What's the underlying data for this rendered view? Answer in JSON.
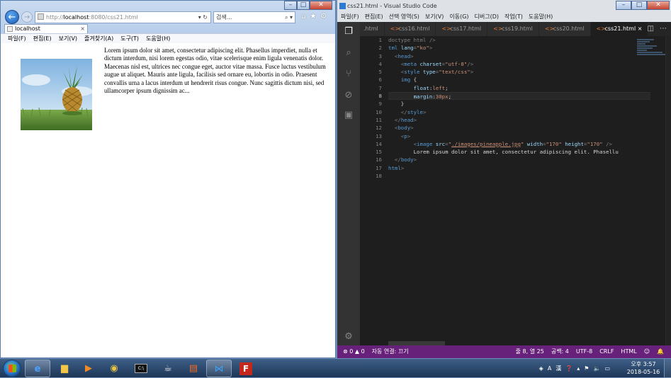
{
  "ie": {
    "address_prefix": "http://",
    "address_domain": "localhost",
    "address_suffix": ":8080/css21.html",
    "address_tools": "▾ ↻",
    "search_placeholder": "검색...",
    "search_tools": "⌕ ▾",
    "tab_title": "localhost",
    "tab_close": "×",
    "menu": [
      "파일(F)",
      "편집(E)",
      "보기(V)",
      "즐겨찾기(A)",
      "도구(T)",
      "도움말(H)"
    ],
    "page_text": "Lorem ipsum dolor sit amet, consectetur adipiscing elit. Phasellus imperdiet, nulla et dictum interdum, nisi lorem egestas odio, vitae scelerisque enim ligula venenatis dolor. Maecenas nisl est, ultrices nec congue eget, auctor vitae massa. Fusce luctus vestibulum augue ut aliquet. Mauris ante ligula, facilisis sed ornare eu, lobortis in odio. Praesent convallis urna a lacus interdum ut hendrerit risus congue. Nunc sagittis dictum nisi, sed ullamcorper ipsum dignissim ac..."
  },
  "vscode": {
    "title": "css21.html - Visual Studio Code",
    "menu": [
      "파일(F)",
      "편집(E)",
      "선택 영역(S)",
      "보기(V)",
      "이동(G)",
      "디버그(D)",
      "작업(T)",
      "도움말(H)"
    ],
    "tabs": [
      ".html",
      "css16.html",
      "css17.html",
      "css19.html",
      "css20.html",
      "css21.html"
    ],
    "active_tab_index": 5,
    "tab_close": "×",
    "line_numbers": [
      "1",
      "2",
      "3",
      "4",
      "5",
      "6",
      "7",
      "8",
      "9",
      "10",
      "11",
      "12",
      "13",
      "14",
      "15",
      "16",
      "17",
      "18"
    ],
    "current_line": 8,
    "code_lines": [
      [
        [
          "p",
          "doctype html />"
        ]
      ],
      [
        [
          "t",
          "tml "
        ],
        [
          "a",
          "lang"
        ],
        [
          "p",
          "="
        ],
        [
          "s",
          "\"ko\""
        ],
        [
          "p",
          ">"
        ]
      ],
      [
        [
          "p",
          "  <"
        ],
        [
          "t",
          "head"
        ],
        [
          "p",
          ">"
        ]
      ],
      [
        [
          "p",
          "    <"
        ],
        [
          "t",
          "meta "
        ],
        [
          "a",
          "charset"
        ],
        [
          "p",
          "="
        ],
        [
          "s",
          "\"utf-8\""
        ],
        [
          "p",
          "/>"
        ]
      ],
      [
        [
          "p",
          "    <"
        ],
        [
          "t",
          "style "
        ],
        [
          "a",
          "type"
        ],
        [
          "p",
          "="
        ],
        [
          "s",
          "\"text/css\""
        ],
        [
          "p",
          ">"
        ]
      ],
      [
        [
          "p",
          "    "
        ],
        [
          "t",
          "img"
        ],
        [
          "d",
          " {"
        ]
      ],
      [
        [
          "p",
          "        "
        ],
        [
          "a",
          "float"
        ],
        [
          "d",
          ":"
        ],
        [
          "s",
          "left"
        ],
        [
          "d",
          ";"
        ]
      ],
      [
        [
          "p",
          "        "
        ],
        [
          "a",
          "margin"
        ],
        [
          "d",
          ":"
        ],
        [
          "s",
          "30px"
        ],
        [
          "d",
          ";"
        ]
      ],
      [
        [
          "d",
          "    }"
        ]
      ],
      [
        [
          "p",
          "    </"
        ],
        [
          "t",
          "style"
        ],
        [
          "p",
          ">"
        ]
      ],
      [
        [
          "p",
          "  </"
        ],
        [
          "t",
          "head"
        ],
        [
          "p",
          ">"
        ]
      ],
      [
        [
          "p",
          "  <"
        ],
        [
          "t",
          "body"
        ],
        [
          "p",
          ">"
        ]
      ],
      [
        [
          "p",
          "    <"
        ],
        [
          "t",
          "p"
        ],
        [
          "p",
          ">"
        ]
      ],
      [
        [
          "p",
          "        <"
        ],
        [
          "t",
          "image "
        ],
        [
          "a",
          "src"
        ],
        [
          "p",
          "="
        ],
        [
          "s",
          "\""
        ],
        [
          "u",
          "./images/pineapple.jpg"
        ],
        [
          "s",
          "\""
        ],
        [
          "a",
          " width"
        ],
        [
          "p",
          "="
        ],
        [
          "s",
          "\"170\""
        ],
        [
          "a",
          " height"
        ],
        [
          "p",
          "="
        ],
        [
          "s",
          "\"170\""
        ],
        [
          "p",
          " />"
        ]
      ],
      [
        [
          "d",
          "        Lorem ipsum dolor sit amet, consectetur adipiscing elit. Phasellu"
        ]
      ],
      [
        [
          "p",
          "  </"
        ],
        [
          "t",
          "body"
        ],
        [
          "p",
          ">"
        ]
      ],
      [
        [
          "t",
          "html"
        ],
        [
          "p",
          ">"
        ]
      ],
      []
    ],
    "status_left": [
      "⊗ 0 ▲ 0",
      "자동 연결: 끄기"
    ],
    "status_right": [
      "줄 8, 열 25",
      "공백: 4",
      "UTF-8",
      "CRLF",
      "HTML",
      "☺",
      "🔔"
    ]
  },
  "taskbar": {
    "clock_time": "오후 3:57",
    "clock_date": "2018-05-16",
    "tray": [
      "◈",
      "A",
      "漢",
      "❓",
      "▴",
      "⚑",
      "🔈",
      "▭"
    ]
  }
}
